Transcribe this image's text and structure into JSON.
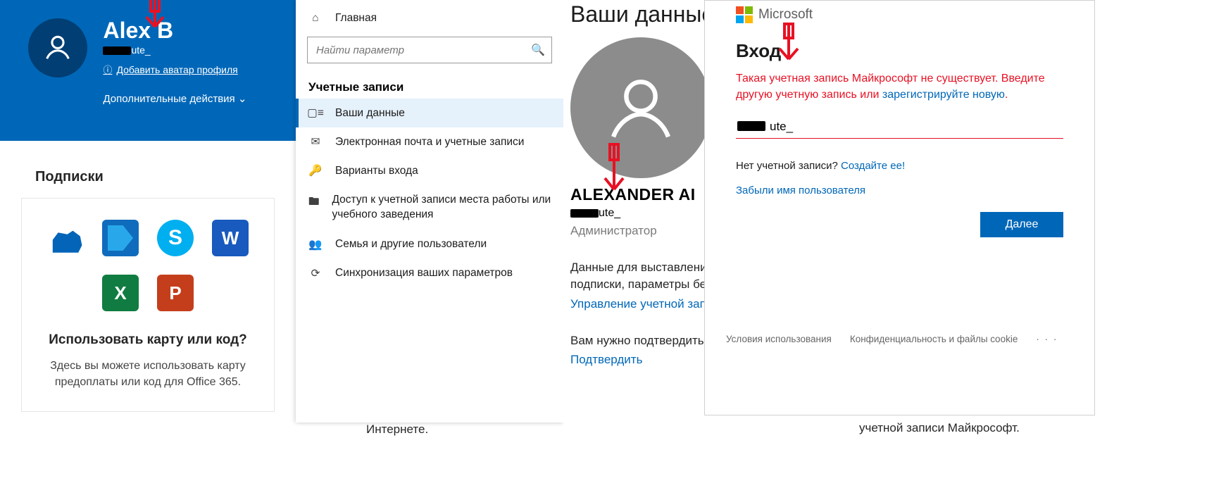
{
  "profile": {
    "name": "Alex B",
    "username_suffix": "ute_",
    "add_avatar": "Добавить аватар профиля",
    "more_actions": "Дополнительные действия"
  },
  "subscriptions": {
    "heading": "Подписки",
    "card_title": "Использовать карту или код?",
    "card_text": "Здесь вы можете использовать карту предоплаты или код для Office 365."
  },
  "settings": {
    "home": "Главная",
    "search_placeholder": "Найти параметр",
    "section": "Учетные записи",
    "items": [
      "Ваши данные",
      "Электронная почта и учетные записи",
      "Варианты входа",
      "Доступ к учетной записи места работы или учебного заведения",
      "Семья и другие пользователи",
      "Синхронизация ваших параметров"
    ],
    "tail": "Интернете."
  },
  "your_info": {
    "heading": "Ваши данные",
    "name": "ALEXANDER AI",
    "email_suffix": "ute_",
    "role": "Администратор",
    "billing_line1": "Данные для выставления",
    "billing_line2": "подписки, параметры бе",
    "manage_link": "Управление учетной зап",
    "verify_text": "Вам нужно подтвердить.",
    "verify_link": "Подтвердить",
    "tail": "учетной записи Майкрософт."
  },
  "login": {
    "brand": "Microsoft",
    "title": "Вход",
    "error_1": "Такая учетная запись Майкрософт не существует. Введите другую учетную запись или ",
    "error_link": "зарегистрируйте новую",
    "error_2": ".",
    "input_suffix": "ute_",
    "no_account": "Нет учетной записи?",
    "create_one": "Создайте ее!",
    "forgot": "Забыли имя пользователя",
    "next": "Далее",
    "footer_terms": "Условия использования",
    "footer_privacy": "Конфиденциальность и файлы cookie",
    "footer_dots": "· · ·"
  }
}
